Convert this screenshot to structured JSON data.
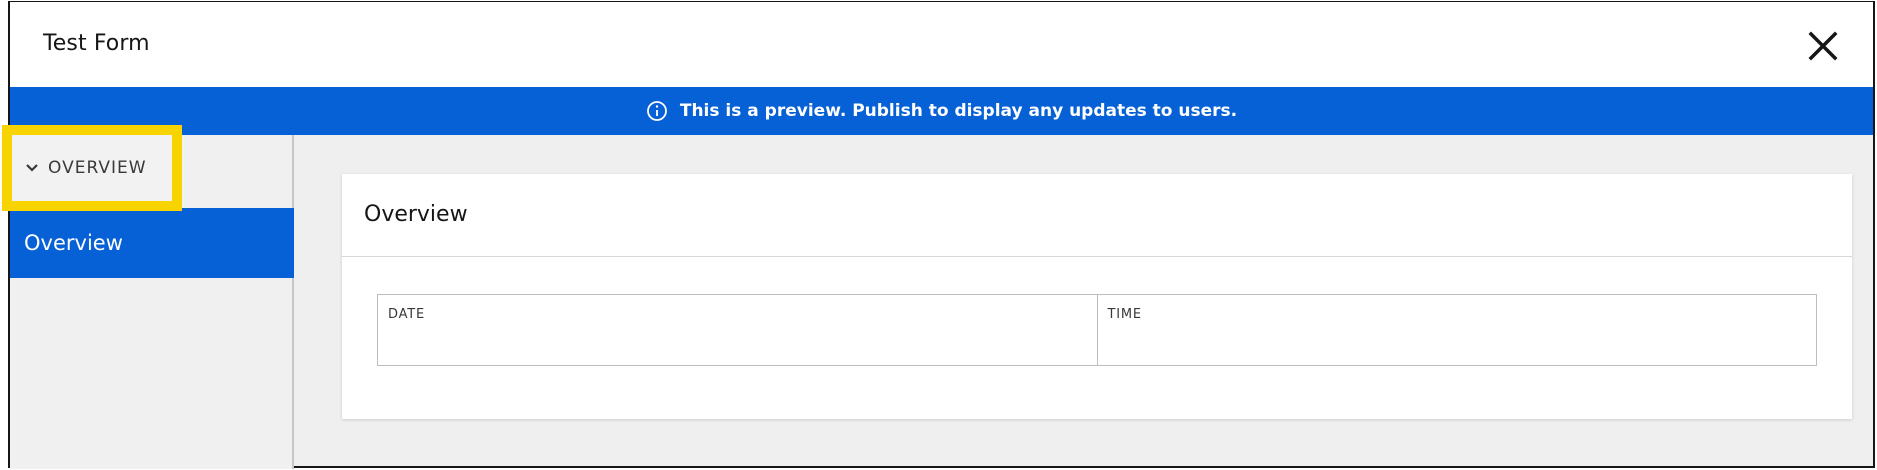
{
  "window": {
    "title": "Test Form",
    "close_icon": "close-icon"
  },
  "banner": {
    "icon": "info-icon",
    "text": "This is a preview. Publish to display any updates to users.",
    "color": "#0761d6"
  },
  "sidebar": {
    "section_toggle": {
      "icon": "chevron-down-icon",
      "label": "OVERVIEW",
      "highlight_color": "#f7d400"
    },
    "items": [
      {
        "label": "Overview",
        "selected": true
      }
    ]
  },
  "main": {
    "card": {
      "title": "Overview",
      "fields": [
        {
          "label": "DATE",
          "value": ""
        },
        {
          "label": "TIME",
          "value": ""
        }
      ]
    }
  }
}
